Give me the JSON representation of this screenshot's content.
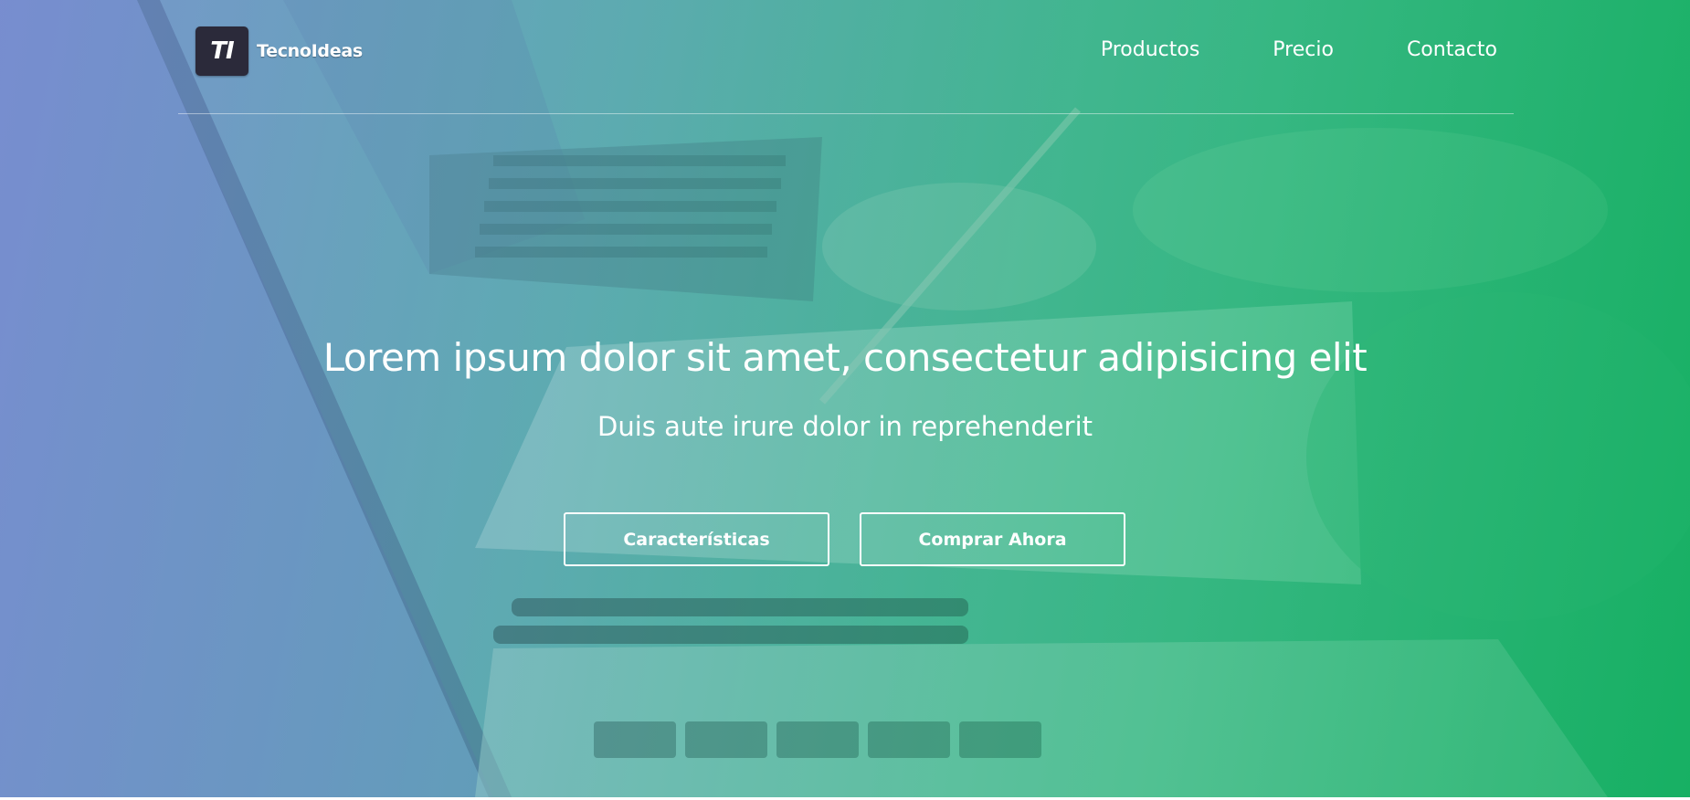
{
  "brand": {
    "mark": "TI",
    "name": "TecnoIdeas"
  },
  "nav": {
    "items": [
      {
        "label": "Productos"
      },
      {
        "label": "Precio"
      },
      {
        "label": "Contacto"
      }
    ]
  },
  "hero": {
    "headline": "Lorem ipsum dolor sit amet, consectetur adipisicing elit",
    "subheadline": "Duis aute irure dolor in reprehenderit",
    "primary_button": "Características",
    "secondary_button": "Comprar Ahora"
  },
  "colors": {
    "gradient_start": "#7c8fd0",
    "gradient_end": "#16b15f",
    "text": "#ffffff",
    "logo_bg": "#2b2a3a"
  }
}
